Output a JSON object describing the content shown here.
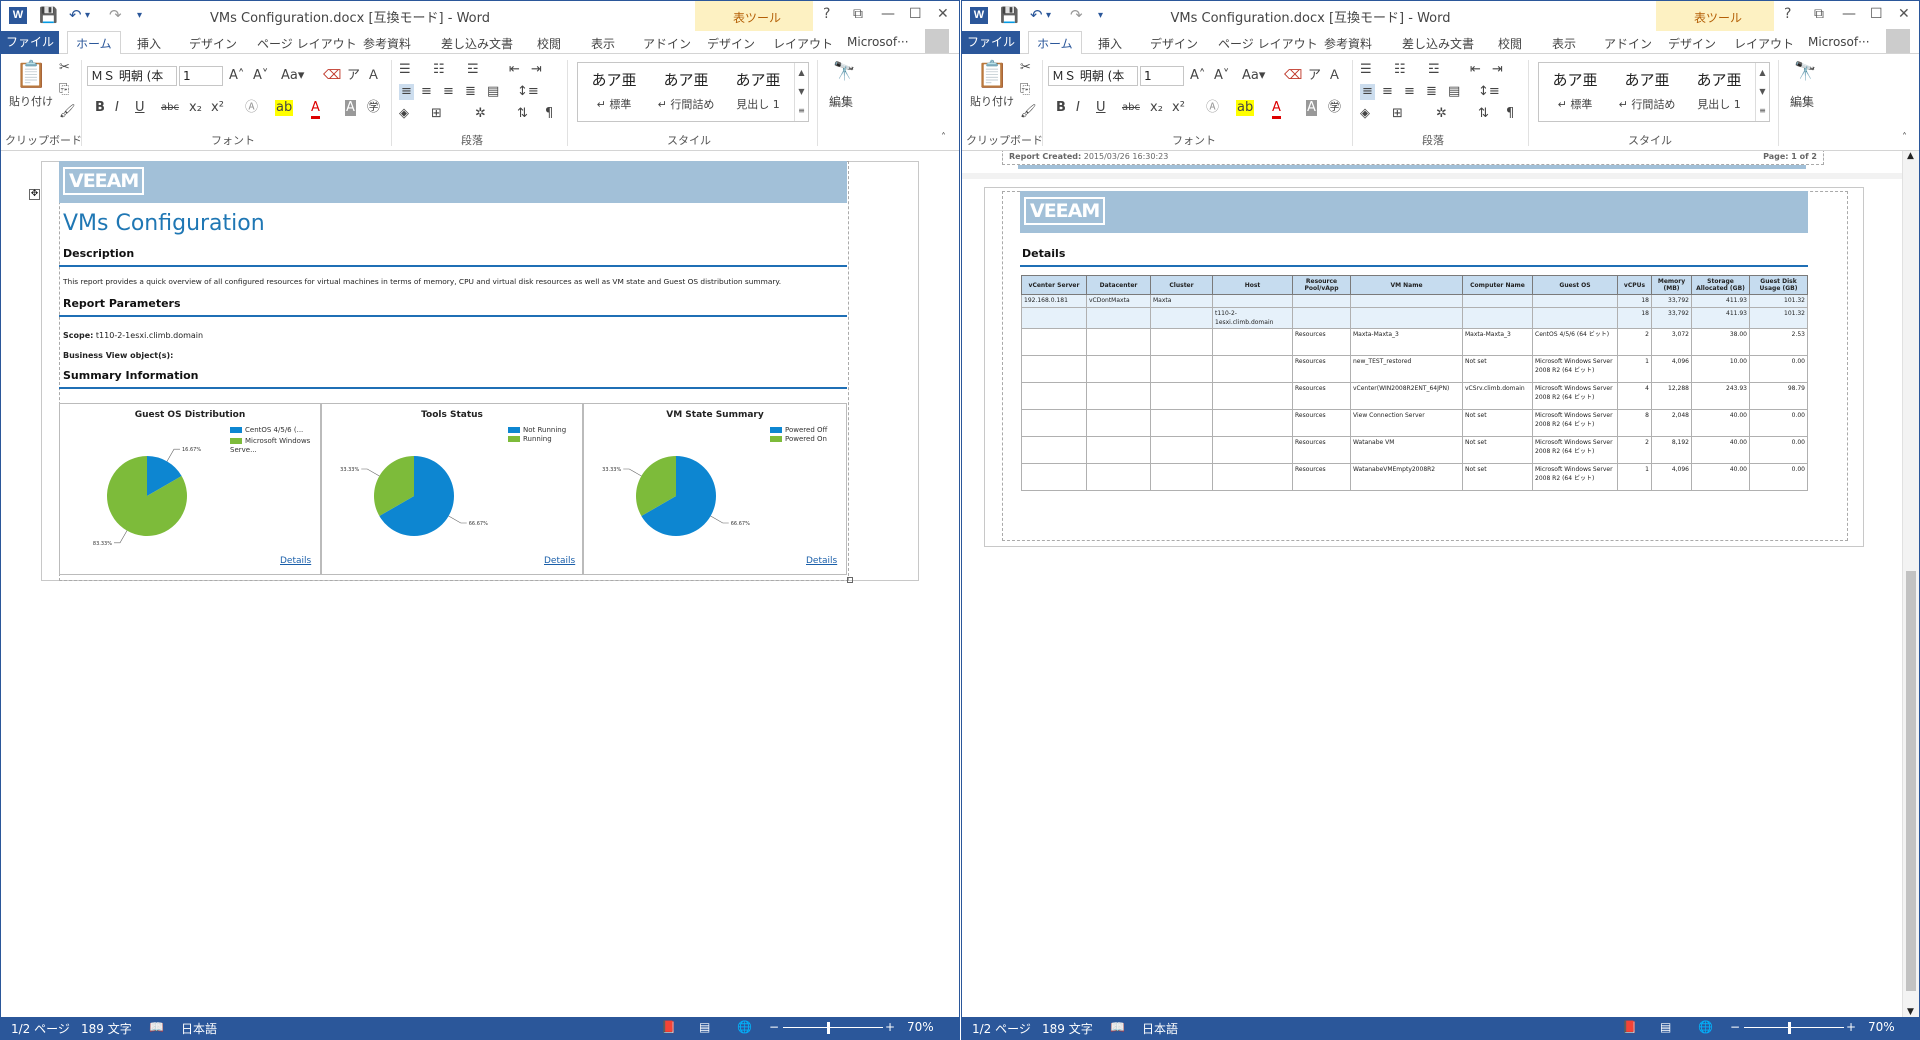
{
  "window_title": "VMs Configuration.docx [互換モード] - Word",
  "context_tab_label": "表ツール",
  "window_buttons": {
    "help": "?",
    "restore": "⧉",
    "minimize": "—",
    "maximize": "☐",
    "close": "✕"
  },
  "tabs": [
    "ファイル",
    "ホーム",
    "挿入",
    "デザイン",
    "ページ レイアウト",
    "参考資料",
    "差し込み文書",
    "校閲",
    "表示",
    "アドイン",
    "デザイン",
    "レイアウト"
  ],
  "account_label": "Microsof···",
  "ribbon": {
    "paste_label": "貼り付け",
    "font_name": "ＭＳ 明朝 (本",
    "font_size": "1",
    "styles": [
      {
        "sample": "あア亜",
        "name": "↵ 標準"
      },
      {
        "sample": "あア亜",
        "name": "↵ 行間詰め"
      },
      {
        "sample": "あア亜",
        "name": "見出し 1"
      }
    ],
    "edit_label": "編集",
    "groups": {
      "clipboard": "クリップボード",
      "font": "フォント",
      "paragraph": "段落",
      "styles": "スタイル"
    }
  },
  "status": {
    "page": "1/2 ページ",
    "words": "189 文字",
    "language": "日本語",
    "zoom": "70%",
    "zoom_level": 0.45
  },
  "doc1": {
    "logo": "VEEAM",
    "title": "VMs Configuration",
    "description_heading": "Description",
    "description_text": "This report provides a quick overview of all configured resources for virtual machines in terms of memory, CPU and virtual disk resources as well as VM state and Guest OS distribution summary.",
    "params_heading": "Report Parameters",
    "scope_label": "Scope:",
    "scope_value": "t110-2-1esxi.climb.domain",
    "bv_label": "Business View object(s):",
    "summary_heading": "Summary Information",
    "details_link": "Details"
  },
  "chart_data": [
    {
      "type": "pie",
      "title": "Guest OS Distribution",
      "categories": [
        "CentOS 4/5/6 (...",
        "Microsoft Windows Serve..."
      ],
      "values": [
        16.67,
        83.33
      ],
      "labels": [
        "16.67%",
        "83.33%"
      ],
      "colors": [
        "#0d86d1",
        "#7dbb3a"
      ]
    },
    {
      "type": "pie",
      "title": "Tools Status",
      "categories": [
        "Not Running",
        "Running"
      ],
      "values": [
        66.67,
        33.33
      ],
      "labels": [
        "66.67%",
        "33.33%"
      ],
      "colors": [
        "#0d86d1",
        "#7dbb3a"
      ]
    },
    {
      "type": "pie",
      "title": "VM State Summary",
      "categories": [
        "Powered Off",
        "Powered On"
      ],
      "values": [
        66.67,
        33.33
      ],
      "labels": [
        "66.67%",
        "33.33%"
      ],
      "colors": [
        "#0d86d1",
        "#7dbb3a"
      ]
    }
  ],
  "doc2": {
    "report_created_label": "Report Created:",
    "report_created_value": "2015/03/26 16:30:23",
    "page_label": "Page:",
    "page_num": "1",
    "of_label": "of",
    "page_total": "2",
    "logo": "VEEAM",
    "details_heading": "Details",
    "table": {
      "headers": [
        "vCenter Server",
        "Datacenter",
        "Cluster",
        "Host",
        "Resource Pool/vApp",
        "VM Name",
        "Computer Name",
        "Guest OS",
        "vCPUs",
        "Memory (MB)",
        "Storage Allocated (GB)",
        "Guest Disk Usage (GB)"
      ],
      "rows": [
        [
          "192.168.0.181",
          "vCDontMaxta",
          "Maxta",
          "",
          "",
          "",
          "",
          "",
          "18",
          "33,792",
          "411.93",
          "101.32"
        ],
        [
          "",
          "",
          "",
          "t110-2-1esxi.climb.domain",
          "",
          "",
          "",
          "",
          "18",
          "33,792",
          "411.93",
          "101.32"
        ],
        [
          "",
          "",
          "",
          "",
          "Resources",
          "Maxta-Maxta_3",
          "Maxta-Maxta_3",
          "CentOS 4/5/6 (64 ビット)",
          "2",
          "3,072",
          "38.00",
          "2.53"
        ],
        [
          "",
          "",
          "",
          "",
          "Resources",
          "new_TEST_restored",
          "Not set",
          "Microsoft Windows Server 2008 R2 (64 ビット)",
          "1",
          "4,096",
          "10.00",
          "0.00"
        ],
        [
          "",
          "",
          "",
          "",
          "Resources",
          "vCenter(WIN2008R2ENT_64JPN)",
          "vCSrv.climb.domain",
          "Microsoft Windows Server 2008 R2 (64 ビット)",
          "4",
          "12,288",
          "243.93",
          "98.79"
        ],
        [
          "",
          "",
          "",
          "",
          "Resources",
          "View Connection Server",
          "Not set",
          "Microsoft Windows Server 2008 R2 (64 ビット)",
          "8",
          "2,048",
          "40.00",
          "0.00"
        ],
        [
          "",
          "",
          "",
          "",
          "Resources",
          "Watanabe VM",
          "Not set",
          "Microsoft Windows Server 2008 R2 (64 ビット)",
          "2",
          "8,192",
          "40.00",
          "0.00"
        ],
        [
          "",
          "",
          "",
          "",
          "Resources",
          "WatanabeVMEmpty2008R2",
          "Not set",
          "Microsoft Windows Server 2008 R2 (64 ビット)",
          "1",
          "4,096",
          "40.00",
          "0.00"
        ]
      ]
    }
  }
}
